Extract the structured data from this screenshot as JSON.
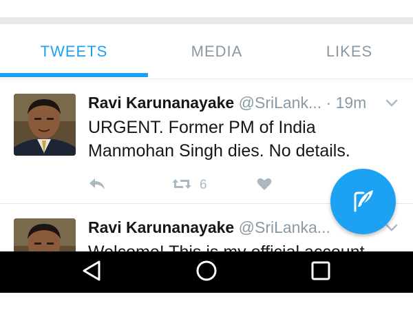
{
  "tabs": [
    {
      "label": "TWEETS",
      "active": true
    },
    {
      "label": "MEDIA",
      "active": false
    },
    {
      "label": "LIKES",
      "active": false
    }
  ],
  "colors": {
    "accent": "#1da1f2",
    "muted": "#8899a6",
    "text": "#14171a",
    "navbar": "#000000"
  },
  "tweets": [
    {
      "name": "Ravi Karunanayake",
      "handle": "@SriLank...",
      "separator": "·",
      "time": "19m",
      "text": "URGENT. Former PM of India Manmohan Singh dies. No details.",
      "retweet_count": "6"
    },
    {
      "name": "Ravi Karunanayake",
      "handle": "@SriLanka...",
      "text": "Welcome! This is my official account"
    }
  ],
  "icons": {
    "reply": "reply-icon",
    "retweet": "retweet-icon",
    "like": "heart-icon",
    "menu": "chevron-down-icon",
    "compose": "compose-icon",
    "nav_back": "back-triangle-icon",
    "nav_home": "home-circle-icon",
    "nav_recent": "recents-square-icon"
  }
}
